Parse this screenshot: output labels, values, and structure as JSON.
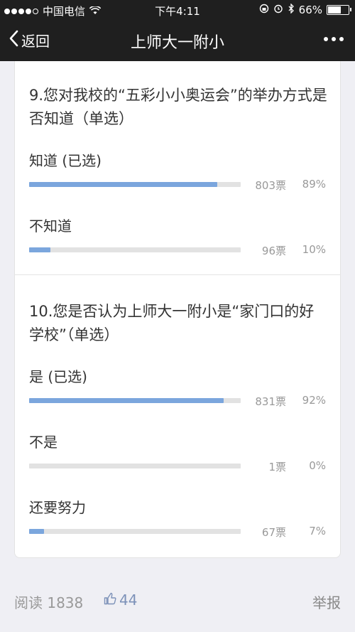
{
  "status_bar": {
    "carrier": "中国电信",
    "time": "下午4:11",
    "battery": "66%",
    "battery_level": 0.66
  },
  "nav": {
    "back_label": "返回",
    "title": "上师大一附小"
  },
  "questions": [
    {
      "title": "9.您对我校的“五彩小小奥运会”的举办方式是否知道（单选）",
      "options": [
        {
          "label": "知道 (已选)",
          "votes": "803票",
          "percent": "89%",
          "fraction": 0.89
        },
        {
          "label": "不知道",
          "votes": "96票",
          "percent": "10%",
          "fraction": 0.1
        }
      ]
    },
    {
      "title": "10.您是否认为上师大一附小是“家门口的好学校”（单选）",
      "options": [
        {
          "label": "是 (已选)",
          "votes": "831票",
          "percent": "92%",
          "fraction": 0.92
        },
        {
          "label": "不是",
          "votes": "1票",
          "percent": "0%",
          "fraction": 0.0
        },
        {
          "label": "还要努力",
          "votes": "67票",
          "percent": "7%",
          "fraction": 0.07
        }
      ]
    }
  ],
  "footer": {
    "reads": "阅读 1838",
    "likes": "44",
    "report": "举报"
  },
  "colors": {
    "bar_fill": "#7ba6dd",
    "bar_track": "#e2e2e2",
    "nav_bg": "#1f1f1f"
  }
}
